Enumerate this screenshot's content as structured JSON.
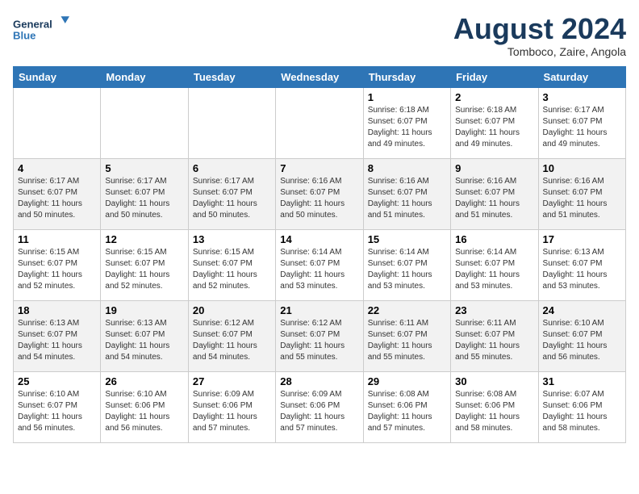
{
  "header": {
    "logo_line1": "General",
    "logo_line2": "Blue",
    "month": "August 2024",
    "location": "Tomboco, Zaire, Angola"
  },
  "weekdays": [
    "Sunday",
    "Monday",
    "Tuesday",
    "Wednesday",
    "Thursday",
    "Friday",
    "Saturday"
  ],
  "weeks": [
    [
      {
        "day": "",
        "info": ""
      },
      {
        "day": "",
        "info": ""
      },
      {
        "day": "",
        "info": ""
      },
      {
        "day": "",
        "info": ""
      },
      {
        "day": "1",
        "info": "Sunrise: 6:18 AM\nSunset: 6:07 PM\nDaylight: 11 hours\nand 49 minutes."
      },
      {
        "day": "2",
        "info": "Sunrise: 6:18 AM\nSunset: 6:07 PM\nDaylight: 11 hours\nand 49 minutes."
      },
      {
        "day": "3",
        "info": "Sunrise: 6:17 AM\nSunset: 6:07 PM\nDaylight: 11 hours\nand 49 minutes."
      }
    ],
    [
      {
        "day": "4",
        "info": "Sunrise: 6:17 AM\nSunset: 6:07 PM\nDaylight: 11 hours\nand 50 minutes."
      },
      {
        "day": "5",
        "info": "Sunrise: 6:17 AM\nSunset: 6:07 PM\nDaylight: 11 hours\nand 50 minutes."
      },
      {
        "day": "6",
        "info": "Sunrise: 6:17 AM\nSunset: 6:07 PM\nDaylight: 11 hours\nand 50 minutes."
      },
      {
        "day": "7",
        "info": "Sunrise: 6:16 AM\nSunset: 6:07 PM\nDaylight: 11 hours\nand 50 minutes."
      },
      {
        "day": "8",
        "info": "Sunrise: 6:16 AM\nSunset: 6:07 PM\nDaylight: 11 hours\nand 51 minutes."
      },
      {
        "day": "9",
        "info": "Sunrise: 6:16 AM\nSunset: 6:07 PM\nDaylight: 11 hours\nand 51 minutes."
      },
      {
        "day": "10",
        "info": "Sunrise: 6:16 AM\nSunset: 6:07 PM\nDaylight: 11 hours\nand 51 minutes."
      }
    ],
    [
      {
        "day": "11",
        "info": "Sunrise: 6:15 AM\nSunset: 6:07 PM\nDaylight: 11 hours\nand 52 minutes."
      },
      {
        "day": "12",
        "info": "Sunrise: 6:15 AM\nSunset: 6:07 PM\nDaylight: 11 hours\nand 52 minutes."
      },
      {
        "day": "13",
        "info": "Sunrise: 6:15 AM\nSunset: 6:07 PM\nDaylight: 11 hours\nand 52 minutes."
      },
      {
        "day": "14",
        "info": "Sunrise: 6:14 AM\nSunset: 6:07 PM\nDaylight: 11 hours\nand 53 minutes."
      },
      {
        "day": "15",
        "info": "Sunrise: 6:14 AM\nSunset: 6:07 PM\nDaylight: 11 hours\nand 53 minutes."
      },
      {
        "day": "16",
        "info": "Sunrise: 6:14 AM\nSunset: 6:07 PM\nDaylight: 11 hours\nand 53 minutes."
      },
      {
        "day": "17",
        "info": "Sunrise: 6:13 AM\nSunset: 6:07 PM\nDaylight: 11 hours\nand 53 minutes."
      }
    ],
    [
      {
        "day": "18",
        "info": "Sunrise: 6:13 AM\nSunset: 6:07 PM\nDaylight: 11 hours\nand 54 minutes."
      },
      {
        "day": "19",
        "info": "Sunrise: 6:13 AM\nSunset: 6:07 PM\nDaylight: 11 hours\nand 54 minutes."
      },
      {
        "day": "20",
        "info": "Sunrise: 6:12 AM\nSunset: 6:07 PM\nDaylight: 11 hours\nand 54 minutes."
      },
      {
        "day": "21",
        "info": "Sunrise: 6:12 AM\nSunset: 6:07 PM\nDaylight: 11 hours\nand 55 minutes."
      },
      {
        "day": "22",
        "info": "Sunrise: 6:11 AM\nSunset: 6:07 PM\nDaylight: 11 hours\nand 55 minutes."
      },
      {
        "day": "23",
        "info": "Sunrise: 6:11 AM\nSunset: 6:07 PM\nDaylight: 11 hours\nand 55 minutes."
      },
      {
        "day": "24",
        "info": "Sunrise: 6:10 AM\nSunset: 6:07 PM\nDaylight: 11 hours\nand 56 minutes."
      }
    ],
    [
      {
        "day": "25",
        "info": "Sunrise: 6:10 AM\nSunset: 6:07 PM\nDaylight: 11 hours\nand 56 minutes."
      },
      {
        "day": "26",
        "info": "Sunrise: 6:10 AM\nSunset: 6:06 PM\nDaylight: 11 hours\nand 56 minutes."
      },
      {
        "day": "27",
        "info": "Sunrise: 6:09 AM\nSunset: 6:06 PM\nDaylight: 11 hours\nand 57 minutes."
      },
      {
        "day": "28",
        "info": "Sunrise: 6:09 AM\nSunset: 6:06 PM\nDaylight: 11 hours\nand 57 minutes."
      },
      {
        "day": "29",
        "info": "Sunrise: 6:08 AM\nSunset: 6:06 PM\nDaylight: 11 hours\nand 57 minutes."
      },
      {
        "day": "30",
        "info": "Sunrise: 6:08 AM\nSunset: 6:06 PM\nDaylight: 11 hours\nand 58 minutes."
      },
      {
        "day": "31",
        "info": "Sunrise: 6:07 AM\nSunset: 6:06 PM\nDaylight: 11 hours\nand 58 minutes."
      }
    ]
  ]
}
